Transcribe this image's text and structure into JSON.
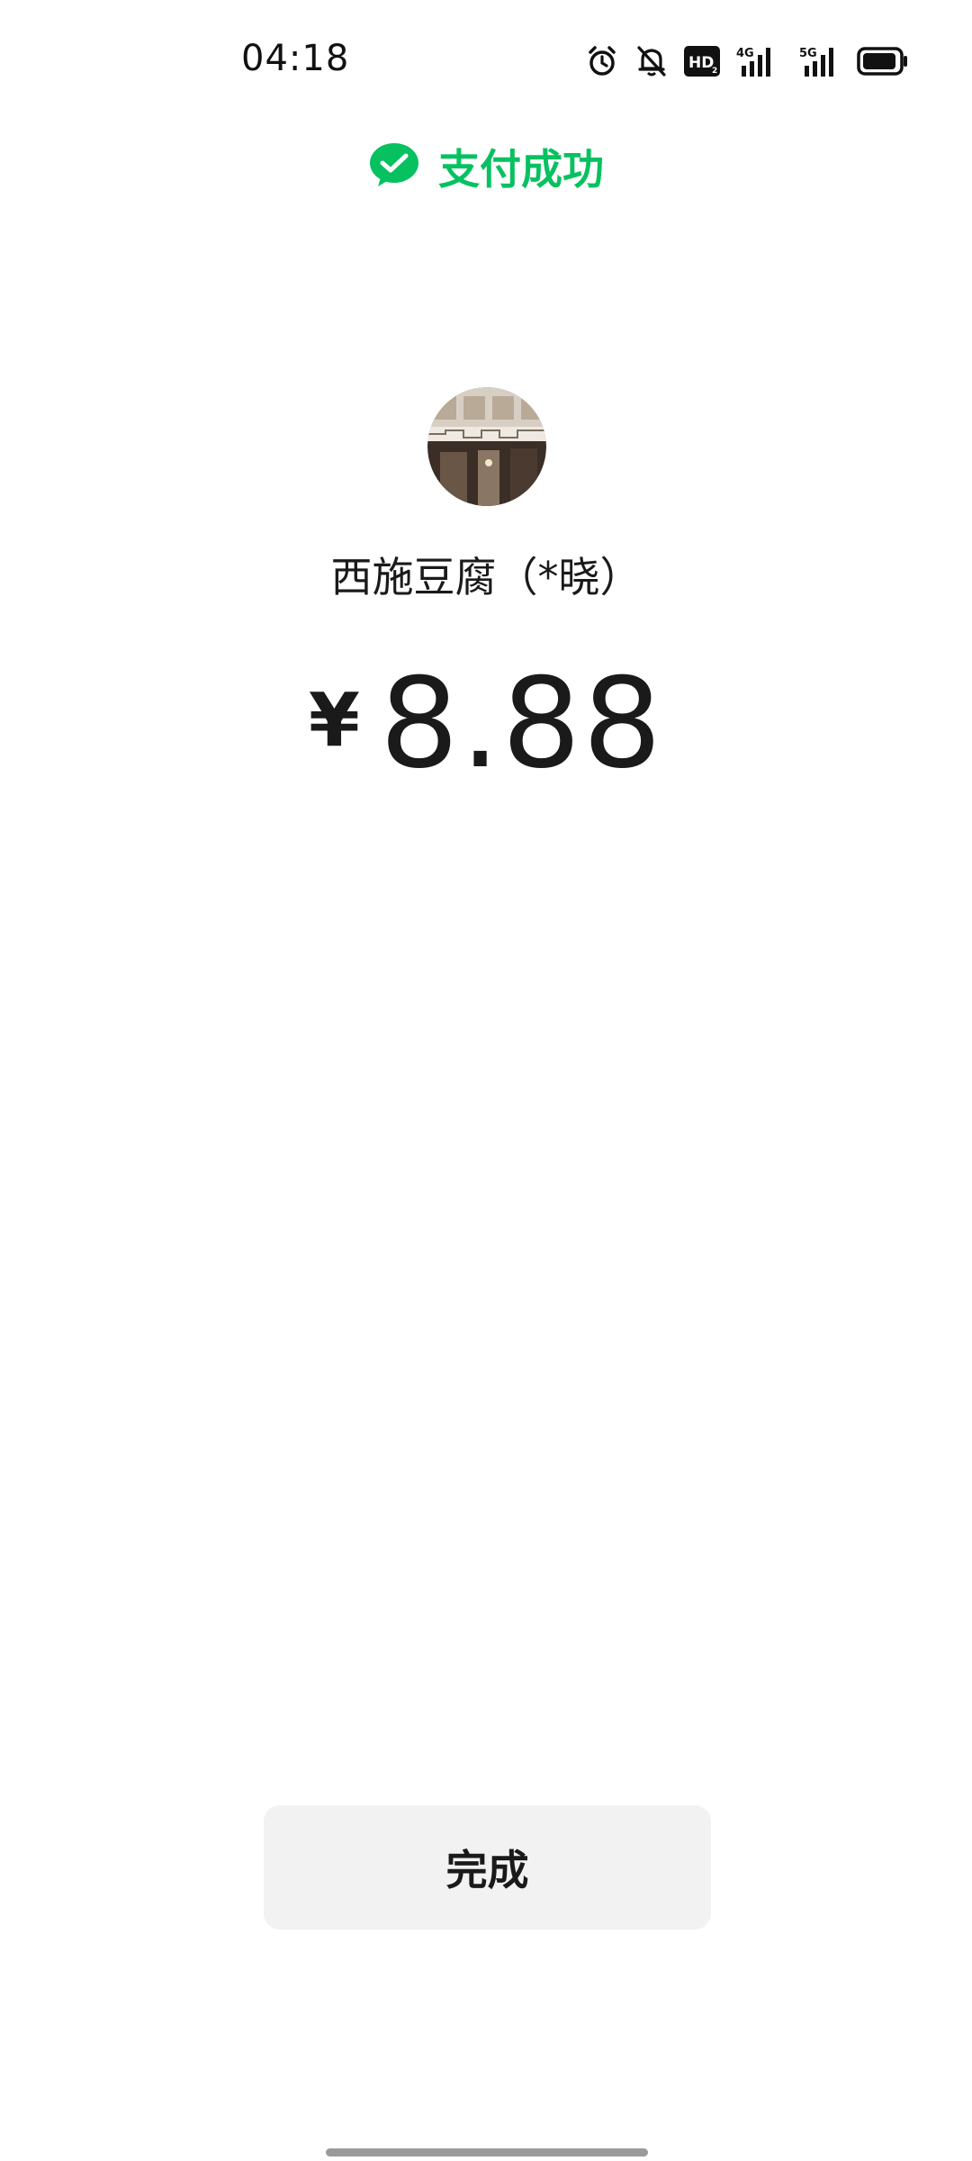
{
  "status_bar": {
    "time": "04:18",
    "icons": [
      "alarm-icon",
      "bell-off-icon",
      "hd-icon",
      "signal-4g-icon",
      "signal-5g-icon",
      "battery-icon"
    ],
    "hd_text": "HD",
    "net1": "4G",
    "net2": "5G"
  },
  "header": {
    "icon": "wechat-pay-check-icon",
    "title": "支付成功",
    "accent_color": "#07c160"
  },
  "merchant": {
    "avatar": "merchant-storefront-photo",
    "name": "西施豆腐（*晓）"
  },
  "payment": {
    "currency": "¥",
    "amount": "8.88"
  },
  "actions": {
    "done_label": "完成"
  }
}
